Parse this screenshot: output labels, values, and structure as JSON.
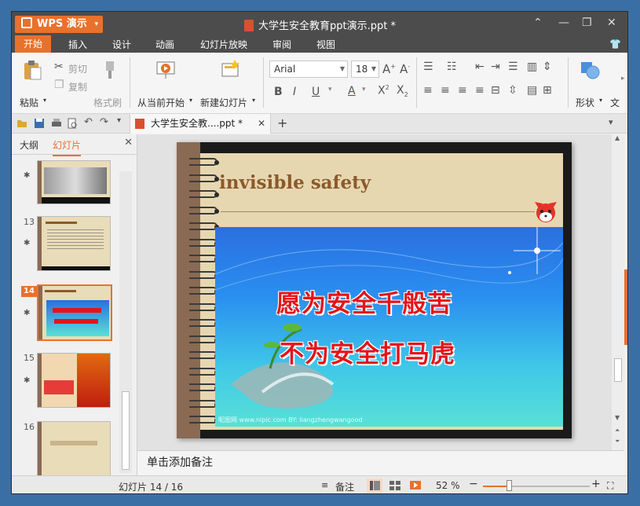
{
  "titlebar": {
    "app_button": "WPS 演示",
    "document_title": "大学生安全教育ppt演示.ppt *"
  },
  "menu": [
    "开始",
    "插入",
    "设计",
    "动画",
    "幻灯片放映",
    "审阅",
    "视图"
  ],
  "ribbon": {
    "paste": "粘贴",
    "cut": "剪切",
    "copy": "复制",
    "format_painter": "格式刷",
    "play_from_current": "从当前开始",
    "new_slide": "新建幻灯片",
    "font_name": "Arial",
    "font_size": "18",
    "shape": "形状",
    "more": "文"
  },
  "doc_tab": {
    "label": "大学生安全教....ppt *"
  },
  "left_panel": {
    "tab_outline": "大纲",
    "tab_slides": "幻灯片",
    "slides": [
      {
        "num": "13"
      },
      {
        "num": "14"
      },
      {
        "num": "15"
      },
      {
        "num": "16"
      }
    ]
  },
  "slide": {
    "title": "invisible safety",
    "line1": "愿为安全千般苦",
    "line2": "不为安全打马虎",
    "watermark": "昵图网 www.nipic.com        BY: liangzhengwangood"
  },
  "notes_placeholder": "单击添加备注",
  "status": {
    "slide_counter": "幻灯片 14 / 16",
    "notes_label": "备注",
    "zoom": "52 %",
    "zoom_level": 0.24
  },
  "colors": {
    "accent": "#e8712c",
    "titlebar": "#4c4c4c",
    "slogan_red": "#e4141a",
    "slide_title_brown": "#8b5a2b"
  }
}
